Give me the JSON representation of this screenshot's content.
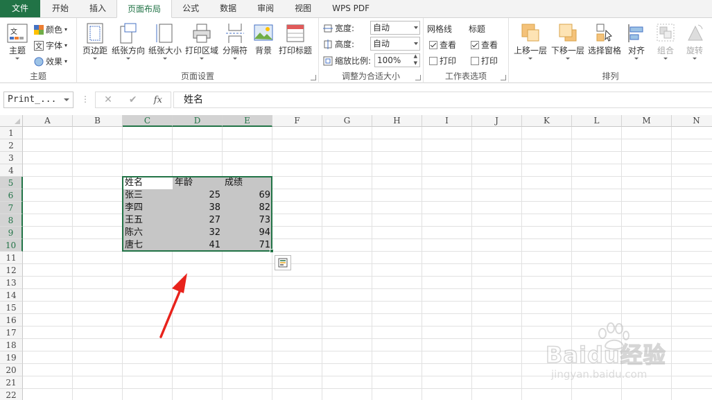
{
  "tabs": [
    {
      "label": "文件",
      "state": "file"
    },
    {
      "label": "开始",
      "state": ""
    },
    {
      "label": "插入",
      "state": ""
    },
    {
      "label": "页面布局",
      "state": "active"
    },
    {
      "label": "公式",
      "state": ""
    },
    {
      "label": "数据",
      "state": ""
    },
    {
      "label": "审阅",
      "state": ""
    },
    {
      "label": "视图",
      "state": ""
    },
    {
      "label": "WPS PDF",
      "state": ""
    }
  ],
  "ribbon": {
    "themes": {
      "label": "主题",
      "theme_btn": "主题",
      "colors": "颜色",
      "fonts": "字体",
      "effects": "效果"
    },
    "page_setup": {
      "label": "页面设置",
      "margins": "页边距",
      "orientation": "纸张方向",
      "size": "纸张大小",
      "print_area": "打印区域",
      "breaks": "分隔符",
      "background": "背景",
      "print_titles": "打印标题"
    },
    "scale": {
      "label": "调整为合适大小",
      "width_label": "宽度:",
      "width_value": "自动",
      "height_label": "高度:",
      "height_value": "自动",
      "scale_label": "缩放比例:",
      "scale_value": "100%"
    },
    "sheet_options": {
      "label": "工作表选项",
      "gridlines": "网格线",
      "headings": "标题",
      "view": "查看",
      "print": "打印",
      "grid_view": true,
      "grid_print": false,
      "head_view": true,
      "head_print": false
    },
    "arrange": {
      "label": "排列",
      "bring_forward": "上移一层",
      "send_backward": "下移一层",
      "selection_pane": "选择窗格",
      "align": "对齐",
      "group": "组合",
      "rotate": "旋转"
    }
  },
  "formula_bar": {
    "name_box": "Print_...",
    "dots": "⋮",
    "cancel": "✕",
    "enter": "✔",
    "fx": "fx",
    "content": "姓名"
  },
  "columns": [
    "A",
    "B",
    "C",
    "D",
    "E",
    "F",
    "G",
    "H",
    "I",
    "J",
    "K",
    "L",
    "M",
    "N"
  ],
  "selected_columns": [
    "C",
    "D",
    "E"
  ],
  "rows": [
    "1",
    "2",
    "3",
    "4",
    "5",
    "6",
    "7",
    "8",
    "9",
    "10",
    "11",
    "12",
    "13",
    "14",
    "15",
    "16",
    "17",
    "18",
    "19",
    "20",
    "21",
    "22"
  ],
  "selected_rows": [
    "5",
    "6",
    "7",
    "8",
    "9",
    "10"
  ],
  "table": {
    "headers": [
      "姓名",
      "年龄",
      "成绩"
    ],
    "rows": [
      [
        "张三",
        "25",
        "69"
      ],
      [
        "李四",
        "38",
        "82"
      ],
      [
        "王五",
        "27",
        "73"
      ],
      [
        "陈六",
        "32",
        "94"
      ],
      [
        "唐七",
        "41",
        "71"
      ]
    ]
  },
  "colors": {
    "accent": "#217346",
    "arrow": "#e8231c"
  },
  "watermark": {
    "brand": "Baidu经验",
    "url": "jingyan.baidu.com"
  }
}
